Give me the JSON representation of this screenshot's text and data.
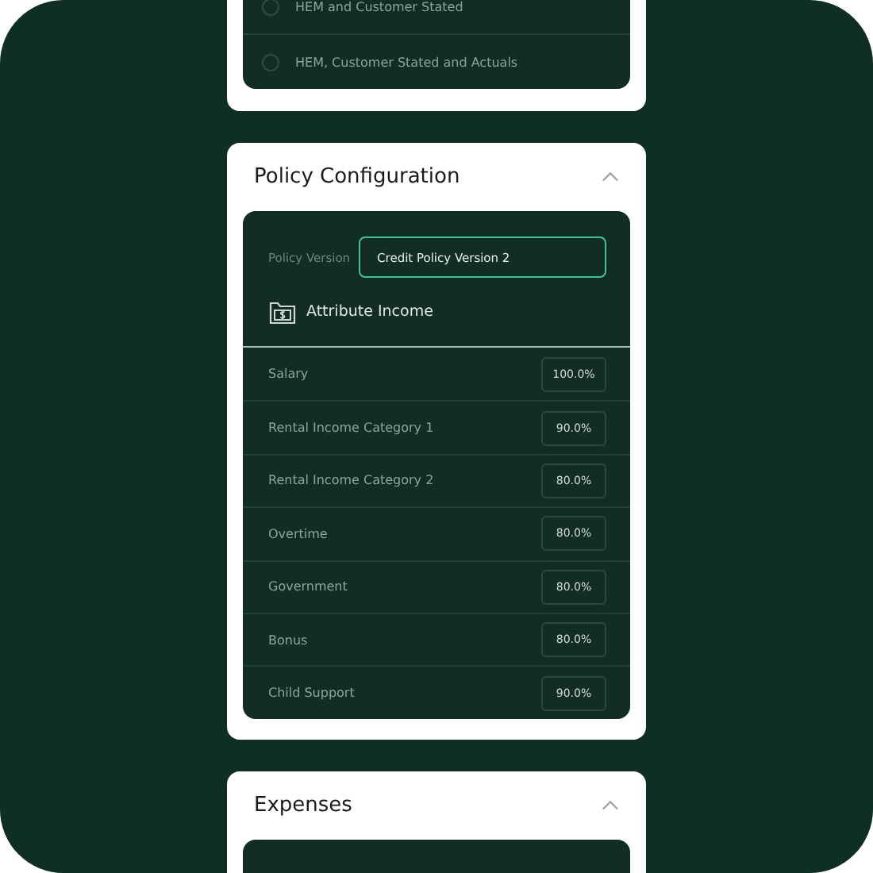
{
  "income_source_options": [
    {
      "label": "HEM and Customer Stated",
      "selected": false
    },
    {
      "label": "HEM, Customer Stated and Actuals",
      "selected": false
    }
  ],
  "policy_configuration": {
    "title": "Policy Configuration",
    "expanded": true,
    "policy_version": {
      "label": "Policy Version",
      "value": "Credit Policy Version 2"
    },
    "section_title": "Attribute Income",
    "attributes": [
      {
        "name": "Salary",
        "value": "100.0%"
      },
      {
        "name": "Rental Income Category 1",
        "value": "90.0%"
      },
      {
        "name": "Rental Income Category 2",
        "value": "80.0%"
      },
      {
        "name": "Overtime",
        "value": "80.0%"
      },
      {
        "name": "Government",
        "value": "80.0%"
      },
      {
        "name": "Bonus",
        "value": "80.0%"
      },
      {
        "name": "Child Support",
        "value": "90.0%"
      }
    ]
  },
  "expenses": {
    "title": "Expenses",
    "expanded": true
  }
}
